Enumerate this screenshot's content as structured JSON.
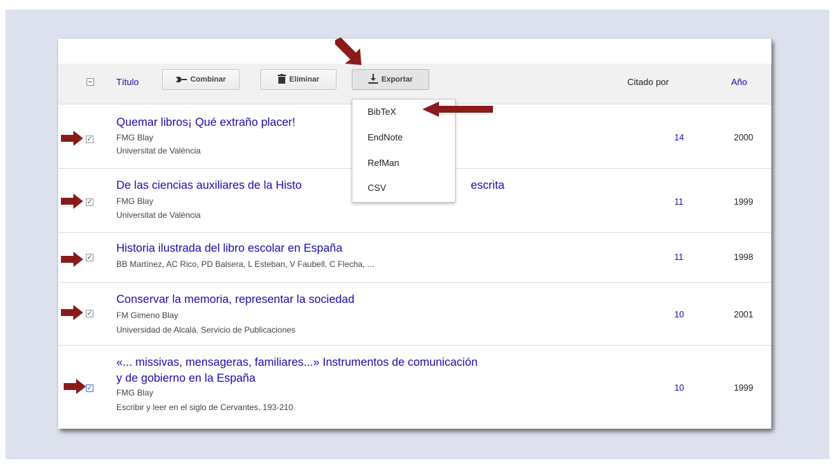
{
  "toolbar": {
    "title_label": "Título",
    "combine_label": "Combinar",
    "delete_label": "Eliminar",
    "export_label": "Exportar",
    "cited_label": "Citado por",
    "year_label": "Año"
  },
  "export_menu": [
    "BibTeX",
    "EndNote",
    "RefMan",
    "CSV"
  ],
  "rows": [
    {
      "title": "Quemar libros¡ Qué extraño placer!",
      "authors": "FMG Blay",
      "source": "Universitat de València",
      "cites": "14",
      "year": "2000"
    },
    {
      "title": "De las ciencias auxiliares de la Histo",
      "title_tail": "escrita",
      "authors": "FMG Blay",
      "source": "Universitat de València",
      "cites": "11",
      "year": "1999"
    },
    {
      "title": "Historia ilustrada del libro escolar en España",
      "authors": "BB Martínez, AC Rico, PD Balsera, L Esteban, V Faubell, C Flecha, ...",
      "cites": "11",
      "year": "1998"
    },
    {
      "title": "Conservar la memoria, representar la sociedad",
      "authors": "FM Gimeno Blay",
      "source": "Universidad de Alcalá. Servicio de Publicaciones",
      "cites": "10",
      "year": "2001"
    },
    {
      "title_line1": "«... missivas, mensageras, familiares...» Instrumentos de comunicación",
      "title_line2": "y de gobierno en la España",
      "authors": "FMG Blay",
      "source": "Escribir y leer en el siglo de Cervantes, 193-210",
      "cites": "10",
      "year": "1999"
    }
  ],
  "colors": {
    "link": "#1a0dab",
    "annotation_arrow": "#8b1a1a",
    "backdrop": "#dde1ee"
  },
  "icons": [
    "select-all-icon",
    "combine-icon",
    "trash-icon",
    "download-icon",
    "checkbox-checked-icon",
    "annotation-arrow-icon"
  ]
}
